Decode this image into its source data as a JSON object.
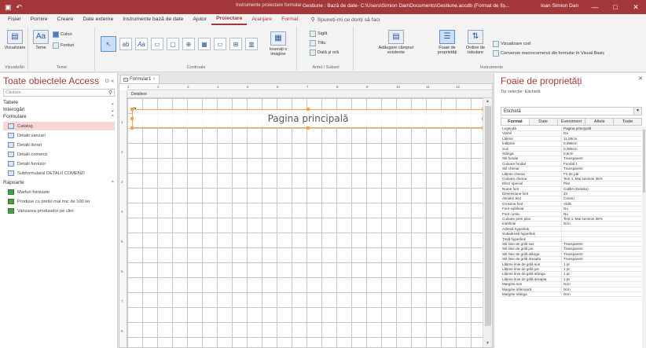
{
  "titlebar": {
    "context_label": "Instrumente proiectare formular",
    "title": "Gestiune : Bază de date- C:\\Users\\Simion Dan\\Documents\\Gestiune.accdb (Format de fiș...",
    "user": "Ioan Simion Dan",
    "minimize": "—",
    "maximize": "□",
    "close": "✕",
    "save_glyph": "▣",
    "undo_glyph": "↶"
  },
  "menu": {
    "tabs": [
      "Fișier",
      "Pornire",
      "Creare",
      "Date externe",
      "Instrumente bază de date",
      "Ajutor",
      "Proiectare",
      "Aranjare",
      "Format"
    ],
    "active_tab": "Proiectare",
    "search": "Spuneți-mi ce doriți să faci"
  },
  "ribbon": {
    "view": {
      "label": "Vizualizare",
      "group": "Vizualizări"
    },
    "themes": {
      "label": "Teme",
      "colors": "Culori",
      "fonts": "Fonturi",
      "group": "Teme"
    },
    "controls": {
      "group": "Controale",
      "insert_image": "Inserați o imagine"
    },
    "header": {
      "logo": "Siglă",
      "title": "Titlu",
      "date_time": "Dată și oră",
      "group": "Antet / Subsol"
    },
    "tools": {
      "add_fields": "Adăugare câmpuri existente",
      "property_sheet": "Foaie de proprietăți",
      "tab_order": "Ordine de tabulare",
      "view_code": "Vizualizare cod",
      "convert_macros": "Conversie macrocomenzi din formular în Visual Basic",
      "group": "Instrumente"
    }
  },
  "nav": {
    "title": "Toate obiectele Access",
    "search_placeholder": "Căutare...",
    "sections": {
      "tables": "Tabele",
      "queries": "Interogări",
      "forms": "Formulare",
      "reports": "Rapoarte"
    },
    "forms": [
      "Catalog",
      "Detalii vanzari",
      "Detalii livrari",
      "Detalii comenzi",
      "Detalii furnizor",
      "Subformularul DETALII COMENZI"
    ],
    "reports": [
      "Marfuri furnizate",
      "Produse cu pretul mai mic de 100 lei",
      "Vanzarea produselor pe clini"
    ],
    "selected_form": "Catalog"
  },
  "designer": {
    "tab_label": "Formular1",
    "tab_close": "×",
    "section": "Detaliere",
    "label_text": "Pagina principală",
    "ruler": [
      "1",
      "2",
      "3",
      "4",
      "5",
      "6",
      "7",
      "8",
      "9",
      "10",
      "11",
      "12"
    ]
  },
  "property_sheet": {
    "title": "Foaie de proprietăți",
    "selection_type": "Tip selecție: Etichetă",
    "selected_object": "Etichetă",
    "tabs": [
      "Format",
      "Date",
      "Eveniment",
      "Altele",
      "Toate"
    ],
    "rows": [
      {
        "name": "Legendă",
        "value": "Pagina principală"
      },
      {
        "name": "Vizibil",
        "value": "Da"
      },
      {
        "name": "Lățime",
        "value": "11,06cm"
      },
      {
        "name": "Înălțime",
        "value": "0,998cm"
      },
      {
        "name": "Sus",
        "value": "0,395cm"
      },
      {
        "name": "Stânga",
        "value": "0,6cm"
      },
      {
        "name": "Stil fundal",
        "value": "Transparent"
      },
      {
        "name": "Culoare fundal",
        "value": "Fundal 1"
      },
      {
        "name": "Stil chenar",
        "value": "Transparent"
      },
      {
        "name": "Lățime chenar",
        "value": "Fir de păr"
      },
      {
        "name": "Culoare chenar",
        "value": "Text 1, Mai luminos 35%"
      },
      {
        "name": "Efect special",
        "value": "Plat"
      },
      {
        "name": "Nume font",
        "value": "Calibri (Detaliu)"
      },
      {
        "name": "Dimensiune font",
        "value": "24"
      },
      {
        "name": "Aliniere text",
        "value": "Centru"
      },
      {
        "name": "Grosime font",
        "value": "Aldin"
      },
      {
        "name": "Font subliniat",
        "value": "Nu"
      },
      {
        "name": "Font cursiv",
        "value": "Nu"
      },
      {
        "name": "Culoare prim plan",
        "value": "Text 1, Mai luminos 35%"
      },
      {
        "name": "Interlinie",
        "value": "0cm"
      },
      {
        "name": "Adresă hyperlink",
        "value": ""
      },
      {
        "name": "Subadresă hyperlink",
        "value": ""
      },
      {
        "name": "Țintă hyperlink",
        "value": ""
      },
      {
        "name": "Stil linie de grilă sus",
        "value": "Transparent"
      },
      {
        "name": "Stil linie de grilă jos",
        "value": "Transparent"
      },
      {
        "name": "Stil linie de grilă stânga",
        "value": "Transparent"
      },
      {
        "name": "Stil linie de grilă dreapta",
        "value": "Transparent"
      },
      {
        "name": "Lățime linie de grilă sus",
        "value": "1 pt"
      },
      {
        "name": "Lățime linie de grilă jos",
        "value": "1 pt"
      },
      {
        "name": "Lățime linie de grilă stânga",
        "value": "1 pt"
      },
      {
        "name": "Lățime linie de grilă dreapta",
        "value": "1 pt"
      },
      {
        "name": "Margine sus",
        "value": "0cm"
      },
      {
        "name": "Margine inferioară",
        "value": "0cm"
      },
      {
        "name": "Margine stânga",
        "value": "0cm"
      }
    ]
  },
  "colors": {
    "accent": "#a4373a",
    "selection": "#f0a64b",
    "grid": "#c6c6c6"
  }
}
